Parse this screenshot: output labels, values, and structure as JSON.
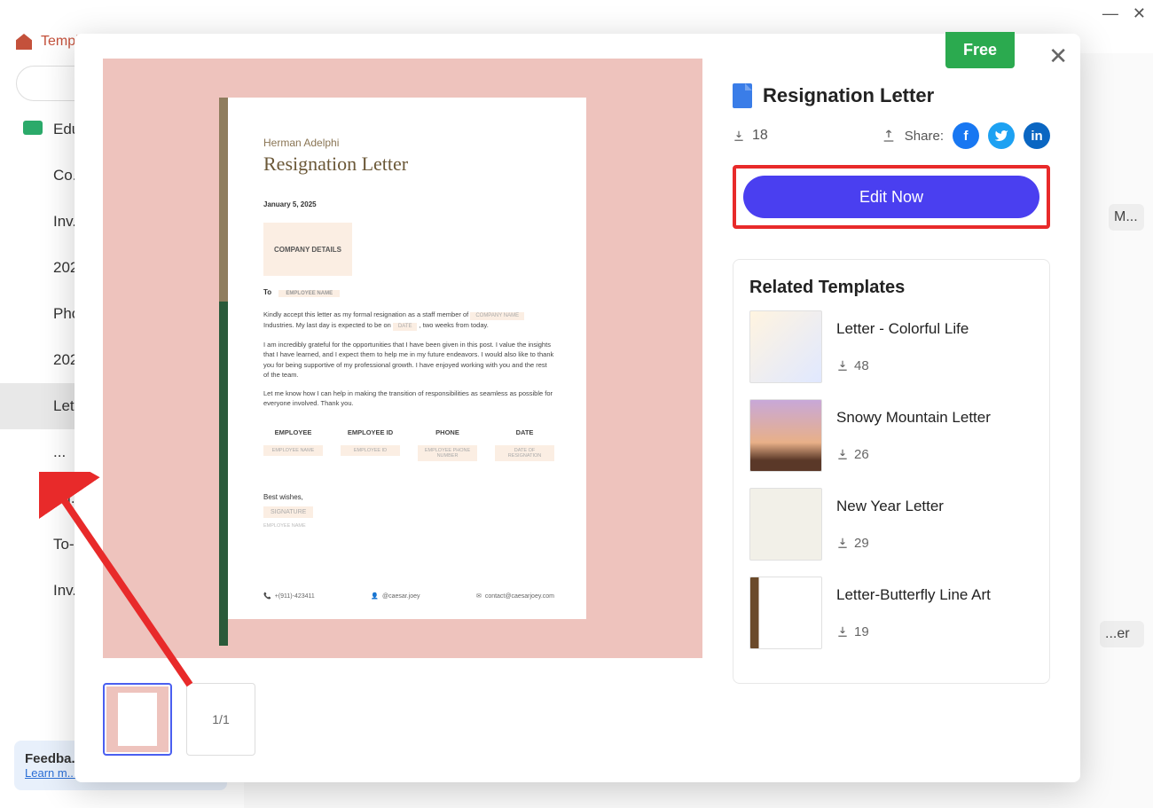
{
  "bg": {
    "app_title": "Template Mall",
    "categories": [
      "Edu...",
      "Co...",
      "Inv...",
      "202...",
      "Pho...",
      "202...",
      "Let...",
      "...",
      "Sti...",
      "To-...",
      "Inv..."
    ],
    "active_category_index": 6,
    "feedback_title": "Feedba...",
    "feedback_link": "Learn m...",
    "bg_card_label": "M...",
    "bg_card_label2": "...er"
  },
  "modal": {
    "free_label": "Free",
    "title": "Resignation Letter",
    "download_count": "18",
    "share_label": "Share:",
    "edit_button": "Edit Now",
    "page_indicator": "1/1",
    "related_title": "Related Templates",
    "related": [
      {
        "name": "Letter - Colorful Life",
        "downloads": "48"
      },
      {
        "name": "Snowy Mountain Letter",
        "downloads": "26"
      },
      {
        "name": "New Year Letter",
        "downloads": "29"
      },
      {
        "name": "Letter-Butterfly Line Art",
        "downloads": "19"
      }
    ]
  },
  "document": {
    "author": "Herman Adelphi",
    "title": "Resignation Letter",
    "date": "January 5, 2025",
    "company_box": "COMPANY DETAILS",
    "to_label": "To",
    "to_placeholder": "EMPLOYEE NAME",
    "para1_a": "Kindly accept this letter as my formal resignation as a staff member of",
    "para1_ph1": "COMPANY NAME",
    "para1_b": "Industries. My last day is expected to be on",
    "para1_ph2": "DATE",
    "para1_c": ", two weeks from today.",
    "para2": "I am incredibly grateful for the opportunities that I have been given in this post. I value the insights that I have learned, and I expect them to help me in my future endeavors. I would also like to thank you for being supportive of my professional growth. I have enjoyed working with you and the rest of the team.",
    "para3": "Let me know how I can help in making the transition of responsibilities as seamless as possible for everyone involved. Thank you.",
    "cols": [
      {
        "h": "EMPLOYEE",
        "v": "EMPLOYEE NAME"
      },
      {
        "h": "EMPLOYEE ID",
        "v": "EMPLOYEE ID"
      },
      {
        "h": "PHONE",
        "v": "EMPLOYEE PHONE NUMBER"
      },
      {
        "h": "DATE",
        "v": "DATE OF RESIGNATION"
      }
    ],
    "best": "Best wishes,",
    "signature": "SIGNATURE",
    "emp_name": "EMPLOYEE NAME",
    "footer_phone": "+(911)-423411",
    "footer_handle": "@caesar.joey",
    "footer_email": "contact@caesarjoey.com"
  }
}
